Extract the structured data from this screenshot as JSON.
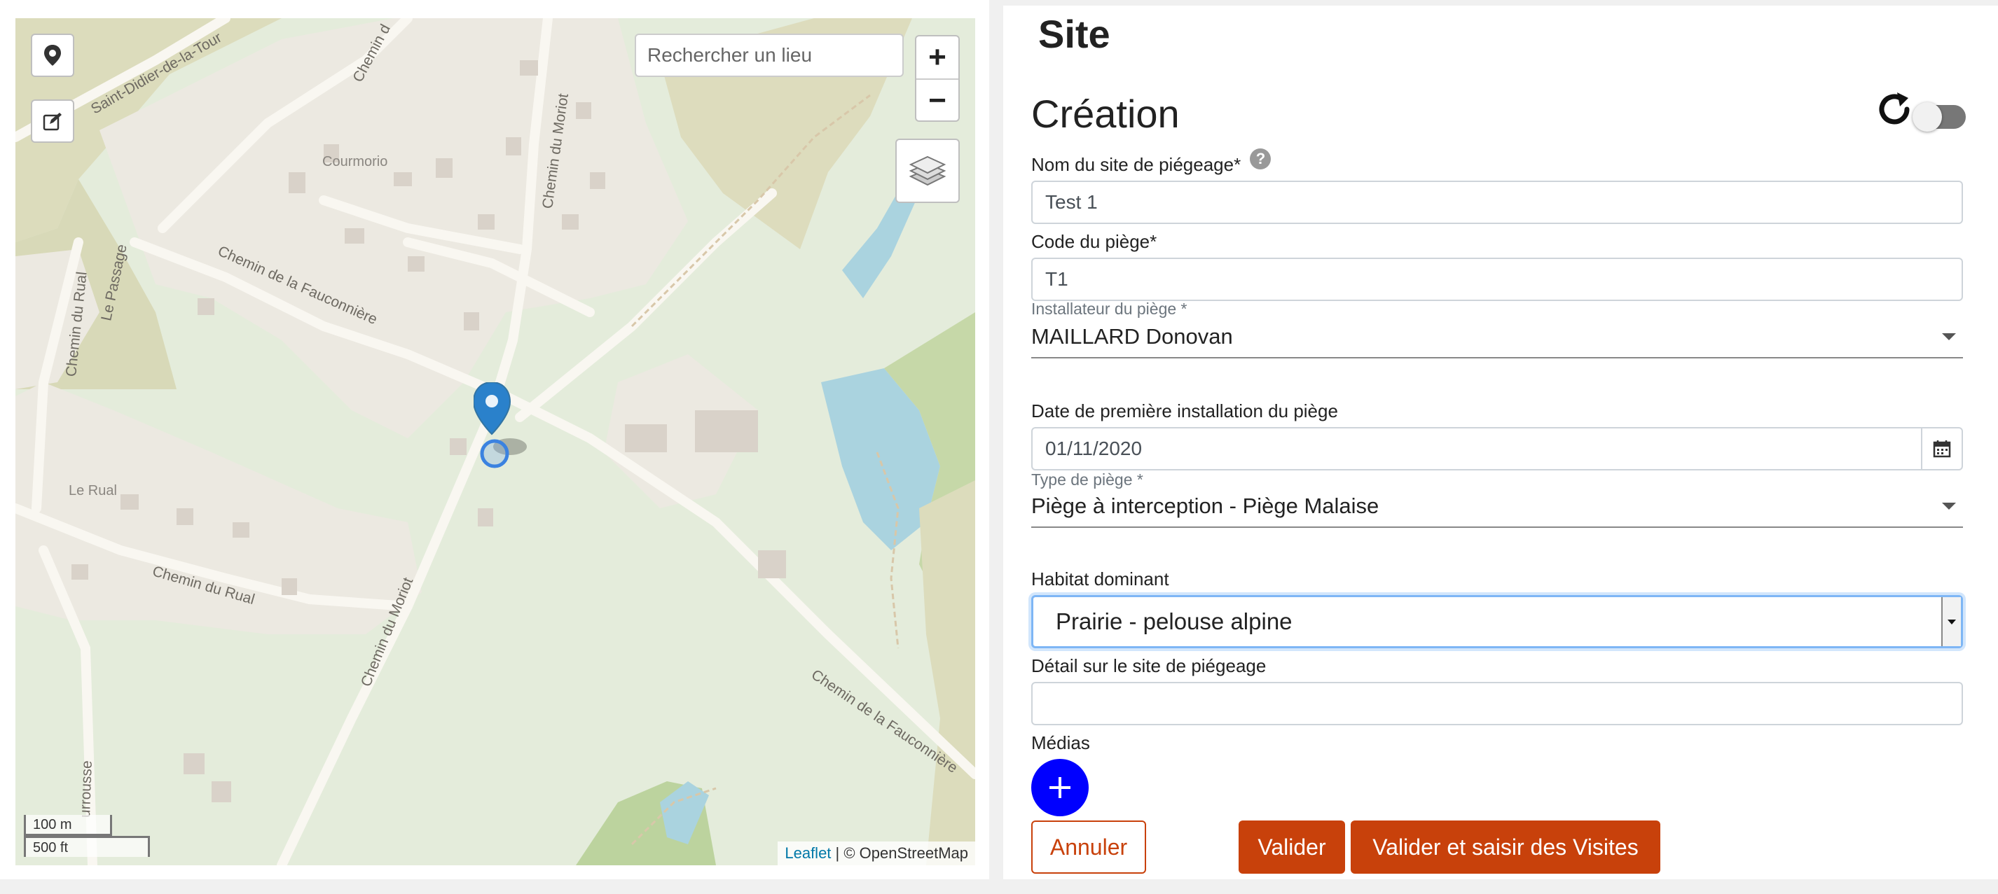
{
  "map": {
    "search_placeholder": "Rechercher un lieu",
    "zoom_in": "+",
    "zoom_out": "−",
    "scale_metric": "100 m",
    "scale_imperial": "500 ft",
    "attribution_link": "Leaflet",
    "attribution_text": " | © OpenStreetMap",
    "streets": [
      "Saint-Didier-de-la-Tour",
      "Chemin d",
      "Chemin du Moriot",
      "Chemin de la Fauconnière",
      "Chemin du Rual",
      "Le Passage",
      "Chemin du Moriot",
      "Chemin du Rual",
      "Chemin de la Fauconnière",
      "urrousse"
    ],
    "places": [
      "Courmorio",
      "Le Rual"
    ]
  },
  "page": {
    "title": "Site",
    "subtitle": "Création"
  },
  "form": {
    "site_name_label": "Nom du site de piégeage*",
    "site_name_value": "Test 1",
    "trap_code_label": "Code du piège*",
    "trap_code_value": "T1",
    "installer_label": "Installateur du piège *",
    "installer_value": "MAILLARD Donovan",
    "install_date_label": "Date de première installation du piège",
    "install_date_value": "01/11/2020",
    "trap_type_label": "Type de piège *",
    "trap_type_value": "Piège à interception - Piège Malaise",
    "habitat_label": "Habitat dominant",
    "habitat_value": "Prairie - pelouse alpine",
    "detail_label": "Détail sur le site de piégeage",
    "detail_value": "",
    "media_label": "Médias",
    "cancel_label": "Annuler",
    "validate_label": "Valider",
    "validate_visits_label": "Valider et saisir des Visites"
  },
  "colors": {
    "primary": "#c8410b",
    "add_button": "#0000ff",
    "marker": "#2a81cb"
  }
}
